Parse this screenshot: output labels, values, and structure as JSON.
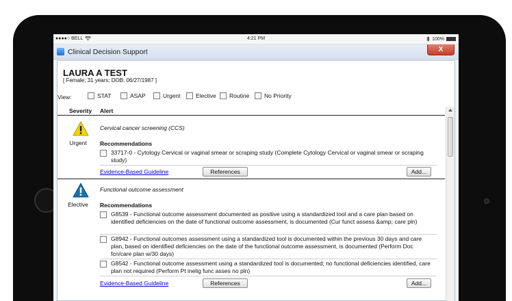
{
  "statusbar": {
    "carrier": "●●●●○ BELL",
    "time": "4:21 PM",
    "battery": "100%",
    "icons": [
      "wifi-icon",
      "bluetooth-icon",
      "battery-icon"
    ]
  },
  "window": {
    "title": "Clinical Decision Support",
    "close_label": "X",
    "accent_color": "#1f6fcf",
    "close_color": "#c3402e"
  },
  "patient": {
    "name": "LAURA A TEST",
    "info": "[ Female; 31 years; DOB: 06/27/1987 ]"
  },
  "view": {
    "label": "View:",
    "filters": [
      {
        "label": "STAT",
        "checked": false
      },
      {
        "label": "ASAP",
        "checked": false
      },
      {
        "label": "Urgent",
        "checked": false
      },
      {
        "label": "Elective",
        "checked": false
      },
      {
        "label": "Routine",
        "checked": false
      },
      {
        "label": "No Priority",
        "checked": false
      }
    ]
  },
  "columns": {
    "severity": "Severity",
    "alert": "Alert"
  },
  "alerts": [
    {
      "severity": "Urgent",
      "severity_color": "#f2d600",
      "icon": "warning-triangle-icon",
      "title": "Cervical cancer screening (CCS)",
      "recommendations_label": "Recommendations",
      "items": [
        {
          "text": "33717-0 - Cytology Cervical or vaginal smear or scraping study (Complete Cytology Cervical or vaginal smear or scraping study)",
          "checked": false
        }
      ],
      "guideline_link": "Evidence-Based Guideline",
      "references_label": "References",
      "add_label": "Add..."
    },
    {
      "severity": "Elective",
      "severity_color": "#1a6fb3",
      "icon": "info-triangle-icon",
      "title": "Functional outcome assessment",
      "recommendations_label": "Recommendations",
      "items": [
        {
          "text": "G8539 - Functional outcome assessment documented as positive using a standardized tool and a care plan based on identified deficiencies on the date of functional outcome assessment, is documented (Cur funct assess &amp; care pln)",
          "checked": false
        },
        {
          "text": "G8942 - Functional outcomes assessment using a standardized tool is documented within the previous 30 days and care plan, based on identified deficiencies on the date of the functional outcome assessment, is documented (Perform Doc fcn/care plan w/30 days)",
          "checked": false
        },
        {
          "text": "G8542 - Functional outcome assessment using a standardized tool is documented; no functional deficiencies identified, care plan not required (Perform Pt inelig func asses no pln)",
          "checked": false
        }
      ],
      "guideline_link": "Evidence-Based Guideline",
      "references_label": "References",
      "add_label": "Add..."
    }
  ]
}
